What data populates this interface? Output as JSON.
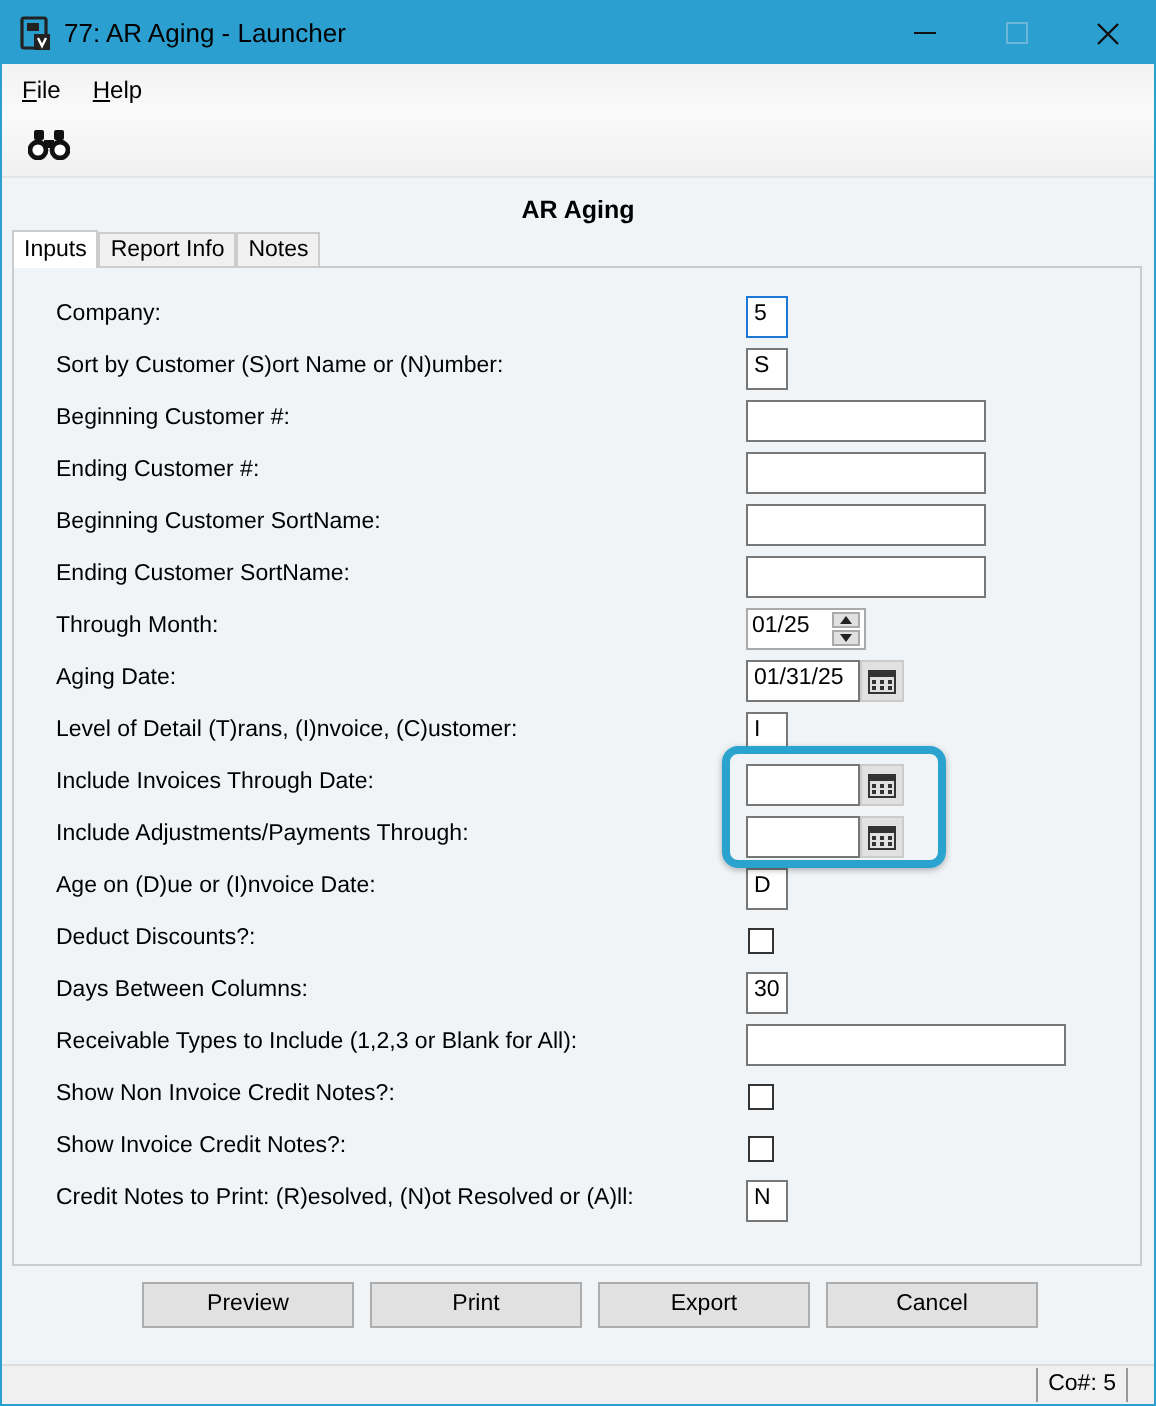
{
  "window": {
    "title": "77: AR Aging - Launcher"
  },
  "menu": [
    {
      "label": "File"
    },
    {
      "label": "Help"
    }
  ],
  "heading": "AR Aging",
  "tabs": [
    {
      "label": "Inputs",
      "selected": true
    },
    {
      "label": "Report Info",
      "selected": false
    },
    {
      "label": "Notes",
      "selected": false
    }
  ],
  "fields": [
    {
      "label": "Company:",
      "kind": "code",
      "value": "5",
      "focused": true,
      "highlighted": false
    },
    {
      "label": "Sort by Customer (S)ort Name or (N)umber:",
      "kind": "code",
      "value": "S",
      "focused": false,
      "highlighted": false
    },
    {
      "label": "Beginning Customer #:",
      "kind": "text",
      "focused": false,
      "highlighted": false
    },
    {
      "label": "Ending Customer #:",
      "kind": "text",
      "focused": false,
      "highlighted": false
    },
    {
      "label": "Beginning Customer SortName:",
      "kind": "text",
      "focused": false,
      "highlighted": false
    },
    {
      "label": "Ending Customer SortName:",
      "kind": "text",
      "focused": false,
      "highlighted": false
    },
    {
      "label": "Through Month:",
      "kind": "spinner",
      "value": "01/25",
      "focused": false,
      "highlighted": false
    },
    {
      "label": "Aging Date:",
      "kind": "date",
      "value": "01/31/25",
      "focused": false,
      "highlighted": false
    },
    {
      "label": "Level of Detail (T)rans, (I)nvoice, (C)ustomer:",
      "kind": "code",
      "value": "I",
      "focused": false,
      "highlighted": false
    },
    {
      "label": "Include Invoices Through Date:",
      "kind": "date",
      "focused": false,
      "highlighted": true
    },
    {
      "label": "Include Adjustments/Payments Through:",
      "kind": "date",
      "focused": false,
      "highlighted": true
    },
    {
      "label": "Age on (D)ue or (I)nvoice Date:",
      "kind": "code",
      "value": "D",
      "focused": false,
      "highlighted": false
    },
    {
      "label": "Deduct Discounts?:",
      "kind": "checkbox",
      "checked": false,
      "highlighted": false
    },
    {
      "label": "Days Between Columns:",
      "kind": "code",
      "value": "30",
      "focused": false,
      "highlighted": false
    },
    {
      "label": "Receivable Types to Include (1,2,3 or Blank for All):",
      "kind": "wide",
      "focused": false,
      "highlighted": false
    },
    {
      "label": "Show Non Invoice Credit Notes?:",
      "kind": "checkbox",
      "checked": false,
      "highlighted": false
    },
    {
      "label": "Show Invoice Credit Notes?:",
      "kind": "checkbox",
      "checked": false,
      "highlighted": false
    },
    {
      "label": "Credit Notes to Print: (R)esolved, (N)ot Resolved or (A)ll:",
      "kind": "code",
      "value": "N",
      "focused": false,
      "highlighted": false
    }
  ],
  "buttons": [
    "Preview",
    "Print",
    "Export",
    "Cancel"
  ],
  "status_bar": {
    "company": "Co#: 5"
  }
}
